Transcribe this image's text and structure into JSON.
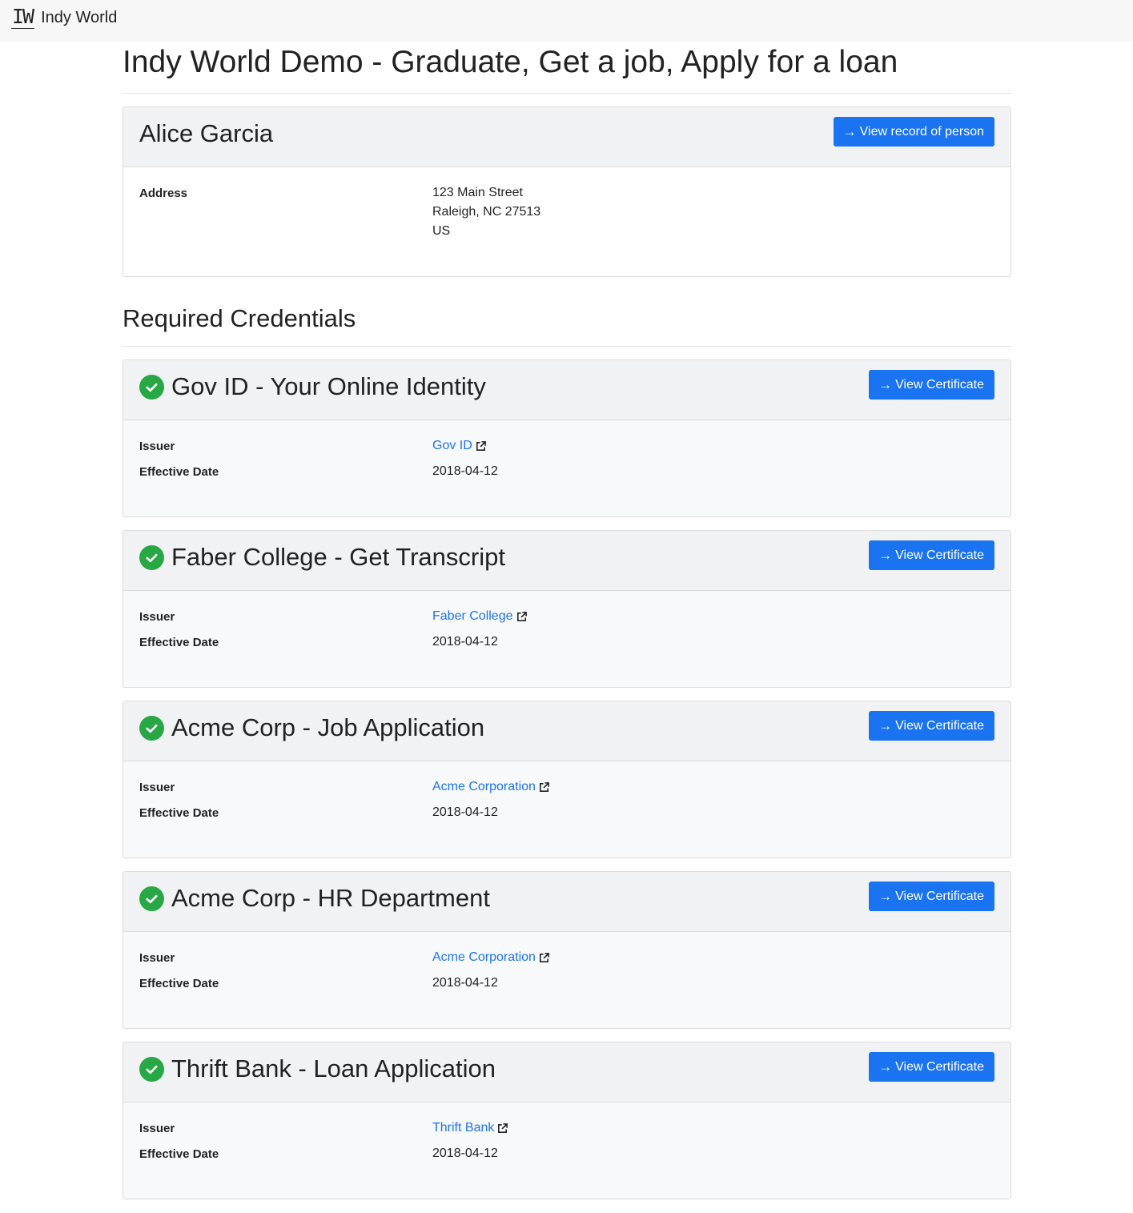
{
  "navbar": {
    "logo_text": "IW",
    "brand": "Indy World"
  },
  "page_title": "Indy World Demo - Graduate, Get a job, Apply for a loan",
  "person": {
    "name": "Alice Garcia",
    "button_label": "View record of person",
    "address_label": "Address",
    "address_lines": [
      "123 Main Street",
      "Raleigh, NC  27513",
      "US"
    ]
  },
  "section_title": "Required Credentials",
  "labels": {
    "issuer": "Issuer",
    "effective_date": "Effective Date",
    "view_certificate": "View Certificate"
  },
  "credentials": [
    {
      "title": "Gov ID - Your Online Identity",
      "issuer": "Gov ID",
      "effective_date": "2018-04-12",
      "status": "verified"
    },
    {
      "title": "Faber College - Get Transcript",
      "issuer": "Faber College",
      "effective_date": "2018-04-12",
      "status": "verified"
    },
    {
      "title": "Acme Corp - Job Application",
      "issuer": "Acme Corporation",
      "effective_date": "2018-04-12",
      "status": "verified"
    },
    {
      "title": "Acme Corp - HR Department",
      "issuer": "Acme Corporation",
      "effective_date": "2018-04-12",
      "status": "verified"
    },
    {
      "title": "Thrift Bank - Loan Application",
      "issuer": "Thrift Bank",
      "effective_date": "2018-04-12",
      "status": "verified"
    }
  ],
  "colors": {
    "primary": "#1a73f0",
    "success": "#28a745",
    "header_bg": "#f1f2f4",
    "navbar_bg": "#f7f7f8"
  },
  "icons": {
    "button": "arrow-right-icon",
    "status": "check-circle-icon",
    "issuer_link": "external-link-icon"
  }
}
